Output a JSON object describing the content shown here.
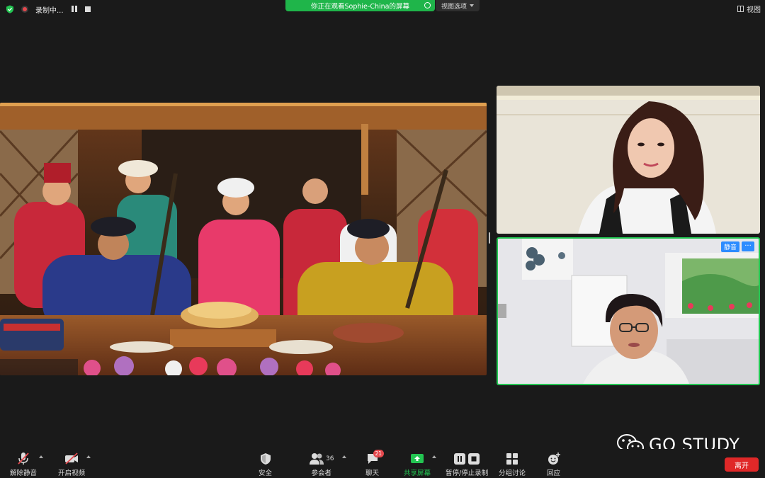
{
  "top": {
    "recording_label": "录制中...",
    "banner_text": "你正在观看Sophie-China的屏幕",
    "view_options_label": "视图选项",
    "view_label": "视图"
  },
  "participants": {
    "tile2_mute_label": "静音",
    "tile2_more_label": "···"
  },
  "watermark": {
    "text": "GO STUDY"
  },
  "toolbar": {
    "unmute_label": "解除静音",
    "start_video_label": "开启视频",
    "security_label": "安全",
    "participants_label": "参会者",
    "participants_count": "36",
    "chat_label": "聊天",
    "chat_badge": "21",
    "share_label": "共享屏幕",
    "record_label": "暂停/停止录制",
    "breakout_label": "分组讨论",
    "reactions_label": "回应",
    "leave_label": "离开"
  },
  "colors": {
    "share_green": "#23c552",
    "leave_red": "#e02828",
    "badge_blue": "#2d8cff"
  }
}
